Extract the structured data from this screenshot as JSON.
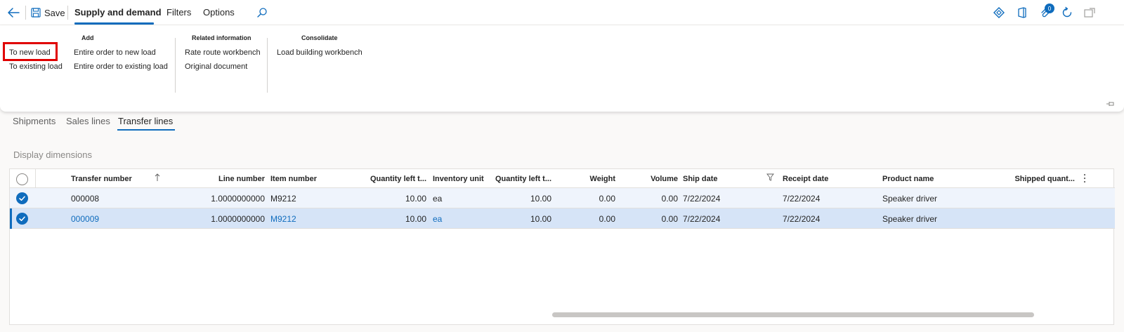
{
  "toolbar": {
    "save_label": "Save",
    "tabs": [
      {
        "label": "Supply and demand",
        "active": true
      },
      {
        "label": "Filters",
        "active": false
      },
      {
        "label": "Options",
        "active": false
      }
    ],
    "notification_count": "0"
  },
  "ribbon": {
    "ungrouped_items": [
      "To new load",
      "To existing load"
    ],
    "groups": [
      {
        "title": "Add",
        "items": [
          "Entire order to new load",
          "Entire order to existing load"
        ]
      },
      {
        "title": "Related information",
        "items": [
          "Rate route workbench",
          "Original document"
        ]
      },
      {
        "title": "Consolidate",
        "items": [
          "Load building workbench"
        ]
      }
    ],
    "highlighted_item": "To new load",
    "highlight_color": "#e00000"
  },
  "subtabs": [
    {
      "label": "Shipments",
      "active": false
    },
    {
      "label": "Sales lines",
      "active": false
    },
    {
      "label": "Transfer lines",
      "active": true
    }
  ],
  "display_dimensions": "Display dimensions",
  "grid": {
    "columns": [
      "Transfer number",
      "Line number",
      "Item number",
      "Quantity left t...",
      "Inventory unit",
      "Quantity left t...",
      "Weight",
      "Volume",
      "Ship date",
      "Receipt date",
      "Product name",
      "Shipped quant..."
    ],
    "rows": [
      {
        "selected": true,
        "transfer_number": "000008",
        "line_number": "1.0000000000",
        "item_number": "M9212",
        "qty_left_1": "10.00",
        "inventory_unit": "ea",
        "qty_left_2": "10.00",
        "weight": "0.00",
        "volume": "0.00",
        "ship_date": "7/22/2024",
        "receipt_date": "7/22/2024",
        "product_name": "Speaker driver"
      },
      {
        "selected": true,
        "transfer_number": "000009",
        "line_number": "1.0000000000",
        "item_number": "M9212",
        "qty_left_1": "10.00",
        "inventory_unit": "ea",
        "qty_left_2": "10.00",
        "weight": "0.00",
        "volume": "0.00",
        "ship_date": "7/22/2024",
        "receipt_date": "7/22/2024",
        "product_name": "Speaker driver"
      }
    ]
  },
  "colors": {
    "accent": "#0f6cbd",
    "row_selected": "#eff4fc",
    "row_active": "#d6e4f7"
  }
}
